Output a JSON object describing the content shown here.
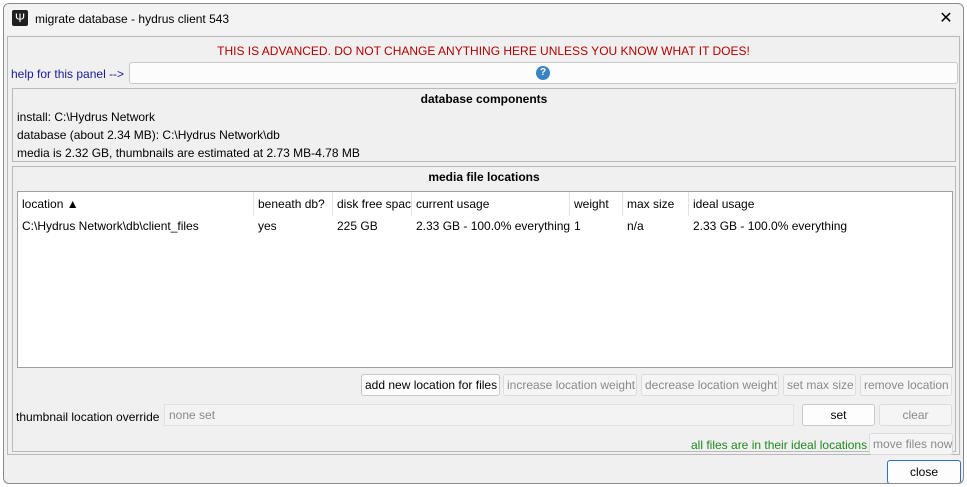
{
  "window": {
    "title": "migrate database - hydrus client 543",
    "icon": "psi-icon",
    "close_glyph": "✕"
  },
  "warning": "THIS IS ADVANCED. DO NOT CHANGE ANYTHING HERE UNLESS YOU KNOW WHAT IT DOES!",
  "help": {
    "label": "help for this panel -->",
    "button_glyph": "?"
  },
  "db_components": {
    "title": "database components",
    "install": "install: C:\\Hydrus Network",
    "database": "database (about 2.34 MB): C:\\Hydrus Network\\db",
    "media": "media is 2.32 GB, thumbnails are estimated at 2.73 MB-4.78 MB"
  },
  "media_locations": {
    "title": "media file locations",
    "columns": [
      "location ▲",
      "beneath db?",
      "disk free spac",
      "current usage",
      "weight",
      "max size",
      "ideal usage"
    ],
    "rows": [
      [
        "C:\\Hydrus Network\\db\\client_files",
        "yes",
        "225 GB",
        "2.33 GB - 100.0% everything",
        "1",
        "n/a",
        "2.33 GB - 100.0% everything"
      ]
    ],
    "buttons": {
      "add": "add new location for files",
      "increase": "increase location weight",
      "decrease": "decrease location weight",
      "set_max": "set max size",
      "remove": "remove location"
    },
    "thumbnail_override": {
      "label": "thumbnail location override",
      "value": "none set",
      "set": "set",
      "clear": "clear"
    },
    "status": "all files are in their ideal locations",
    "move_files": "move files now"
  },
  "footer": {
    "close": "close"
  },
  "colors": {
    "warning": "#b30000",
    "status_ok": "#1f8a1f",
    "help_link": "#1a1a99",
    "accent": "#2a6fd1"
  }
}
